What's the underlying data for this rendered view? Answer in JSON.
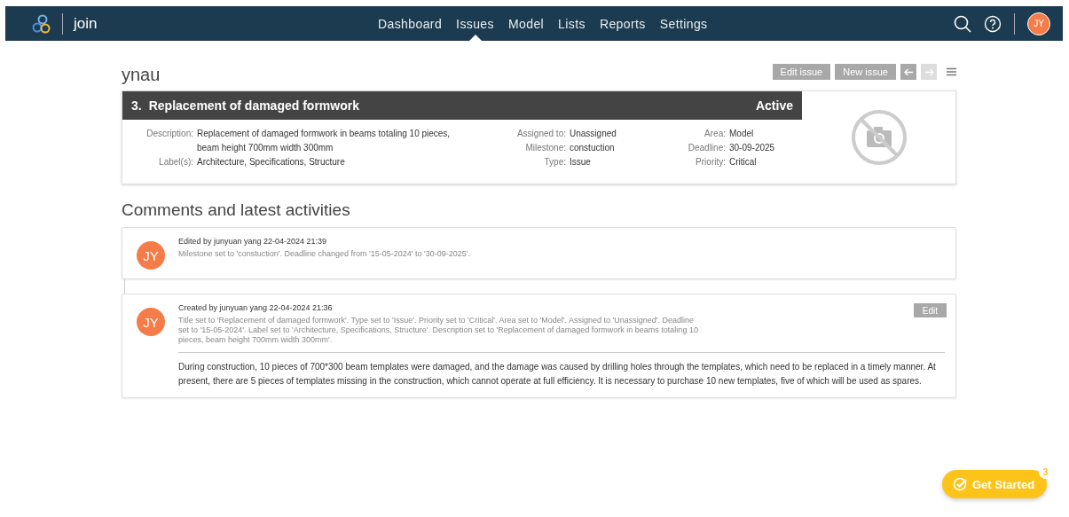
{
  "nav": {
    "brand": "join",
    "items": [
      {
        "label": "Dashboard",
        "selected": false
      },
      {
        "label": "Issues",
        "selected": true
      },
      {
        "label": "Model",
        "selected": false
      },
      {
        "label": "Lists",
        "selected": false
      },
      {
        "label": "Reports",
        "selected": false
      },
      {
        "label": "Settings",
        "selected": false
      }
    ],
    "avatar": "JY"
  },
  "project": "ynau",
  "toolbar": {
    "buttons": [
      "Edit issue",
      "New issue"
    ],
    "prev_disabled": false,
    "next_disabled": true
  },
  "issue": {
    "number": "3.",
    "title": "Replacement of damaged formwork",
    "status": "Active",
    "columns": [
      [
        {
          "label": "Description:",
          "value": "Replacement of damaged formwork in beams totaling 10 pieces, beam height 700mm width 300mm"
        },
        {
          "label": "Label(s):",
          "value": "Architecture, Specifications, Structure"
        }
      ],
      [
        {
          "label": "Assigned to:",
          "value": "Unassigned"
        },
        {
          "label": "Milestone:",
          "value": "constuction"
        },
        {
          "label": "Type:",
          "value": "Issue"
        }
      ],
      [
        {
          "label": "Area:",
          "value": "Model"
        },
        {
          "label": "Deadline:",
          "value": "30-09-2025"
        },
        {
          "label": "Priority:",
          "value": "Critical"
        }
      ]
    ]
  },
  "activities_title": "Comments and latest activities",
  "activities": [
    {
      "avatar": "JY",
      "header": "Edited by junyuan yang 22-04-2024 21:39",
      "changes": "Milestone set to 'constuction'. Deadline changed from '15-05-2024' to '30-09-2025'."
    },
    {
      "avatar": "JY",
      "header": "Created by junyuan yang 22-04-2024 21:36",
      "changes": "Title set to 'Replacement of damaged formwork'. Type set to 'Issue'. Priority set to 'Critical'. Area set to 'Model'. Assigned to 'Unassigned'. Deadline set to '15-05-2024'. Label set to 'Architecture, Specifications, Structure'. Description set to 'Replacement of damaged formwork in beams totaling 10 pieces, beam height 700mm width 300mm'.",
      "edit": "Edit",
      "comment": "During construction, 10 pieces of 700*300 beam templates were damaged, and the damage was caused by drilling holes through the templates, which need to be replaced in a timely manner. At present, there are 5 pieces of templates missing in the construction, which cannot operate at full efficiency. It is necessary to purchase 10 new templates, five of which will be used as spares."
    }
  ],
  "get_started": {
    "label": "Get Started",
    "badge": "3"
  }
}
